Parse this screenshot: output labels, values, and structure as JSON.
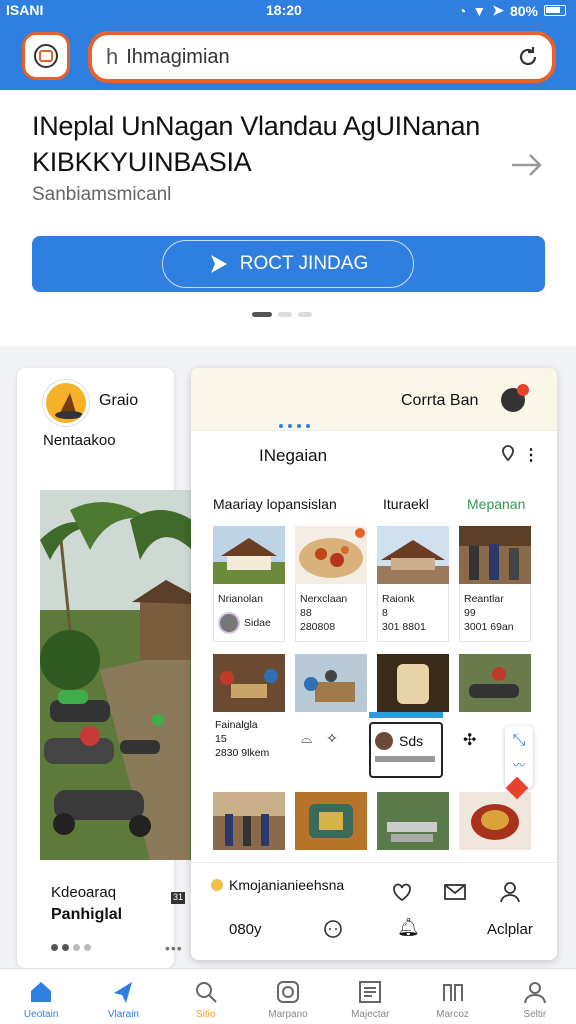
{
  "status": {
    "carrier": "ISANI",
    "time": "18:20",
    "battery": "80%"
  },
  "search": {
    "value": "Ihmagimian",
    "cursor": "h"
  },
  "hero": {
    "title": "INeplal UnNagan Vlandau AgUINanan KIBKKYUINBASIA",
    "subtitle": "Sanbiamsmicanl",
    "button_label": "ROCT JINDAG"
  },
  "left_card": {
    "name": "Graio",
    "place": "Nentaakoo",
    "caption1": "Kdeoaraq",
    "caption2": "Panhiglal",
    "badge": "31",
    "more": "•••"
  },
  "panel": {
    "header_title": "Corrta Ban",
    "title": "INegaian",
    "tabs": [
      "Maariay lopansislan",
      "Ituraekl",
      "Mepanan"
    ],
    "tiles": [
      {
        "line1": "Nrianolan",
        "line2": "",
        "line3": "Sidae"
      },
      {
        "line1": "Nerxclaan",
        "line2": "88",
        "line3": "280808"
      },
      {
        "line1": "Raionk",
        "line2": "8",
        "line3": "301 8801"
      },
      {
        "line1": "Reantlar",
        "line2": "99",
        "line3": "3001 69an"
      }
    ],
    "row2_caption": {
      "line1": "Fainalgla",
      "line2": "15",
      "line3": "2830 9lkem"
    },
    "selected_label": "Sds",
    "bottom_label": "Kmojanianieehsna",
    "bottom_left": "080y",
    "bottom_right": "Aclplar"
  },
  "nav": {
    "items": [
      "Ueotain",
      "Vlarain",
      "Sitio",
      "Marpano",
      "Majectar",
      "Marcoz",
      "Seltir"
    ]
  },
  "colors": {
    "accent": "#2f7fe0",
    "orange": "#e8612c",
    "green": "#2e9b4f"
  }
}
